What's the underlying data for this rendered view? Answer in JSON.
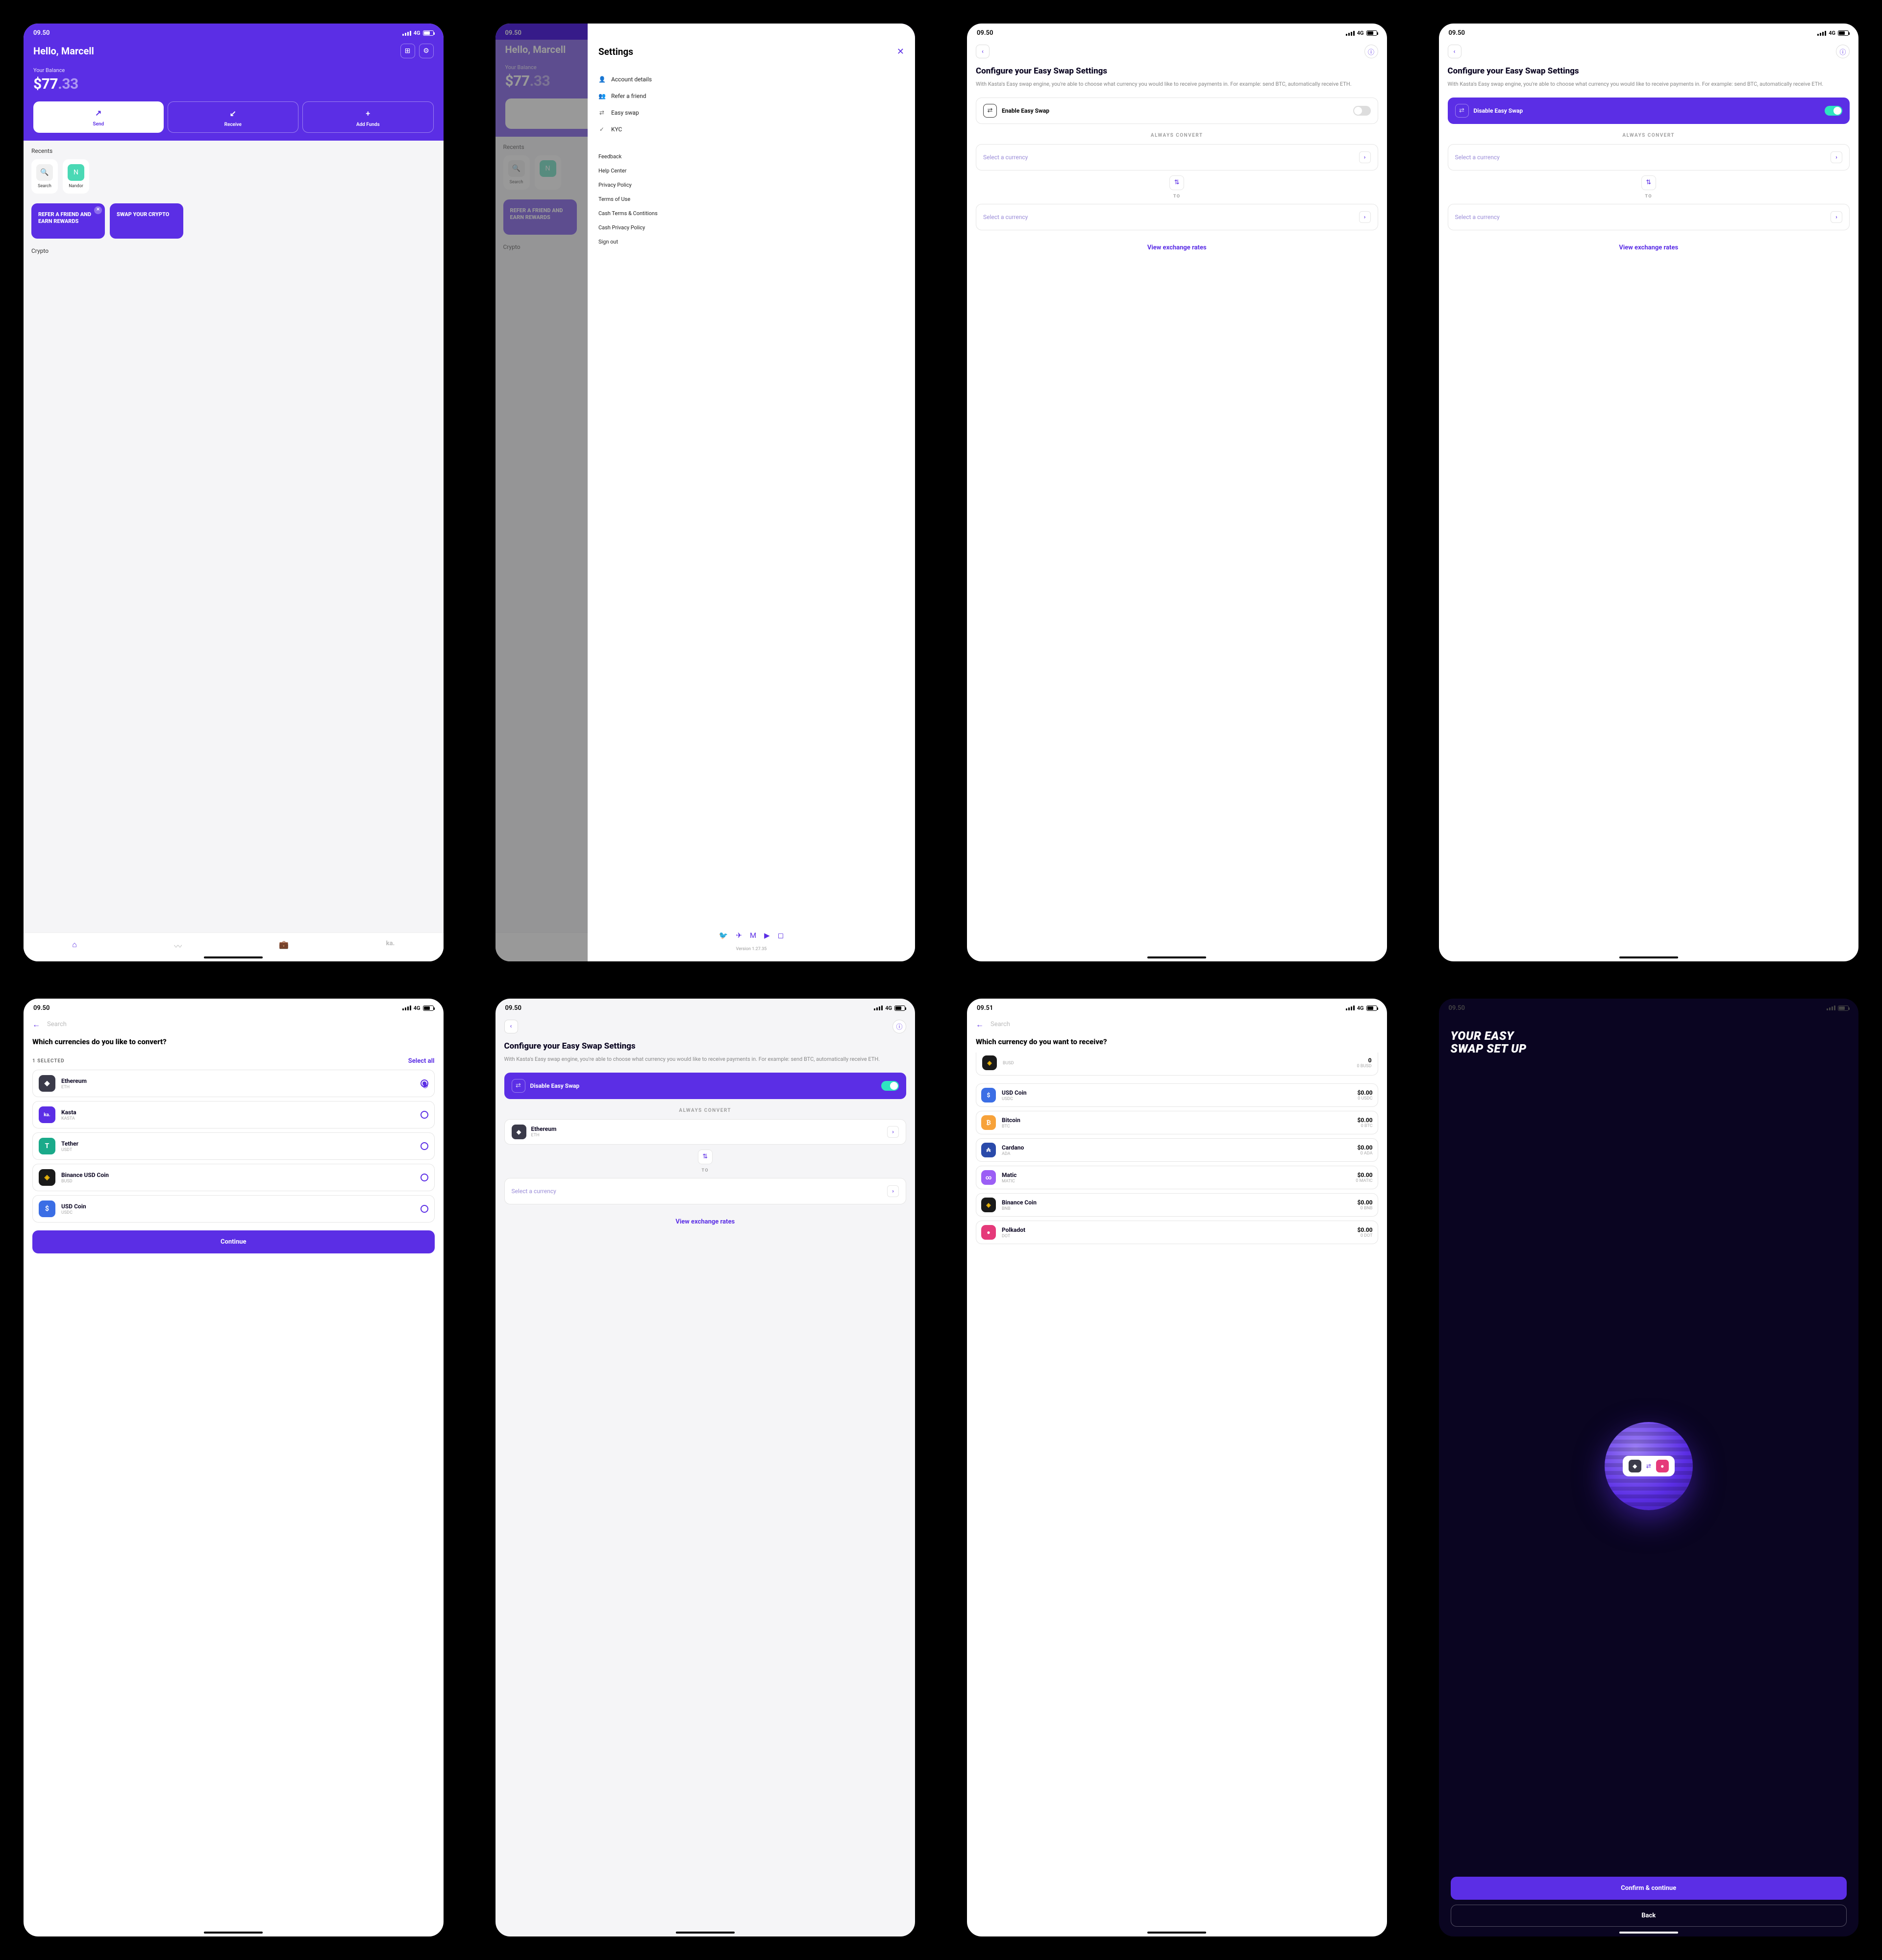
{
  "status": {
    "time": "09.50",
    "time_alt": "09.51",
    "network": "4G"
  },
  "home": {
    "greeting": "Hello, Marcell",
    "balance_label": "Your Balance",
    "balance_whole": "$77",
    "balance_cents": ".33",
    "send": "Send",
    "receive": "Receive",
    "add_funds": "Add Funds",
    "recents_label": "Recents",
    "search_chip": "Search",
    "contact1": "Nandor",
    "promo1": "REFER A FRIEND AND EARN REWARDS",
    "promo2": "SWAP YOUR CRYPTO",
    "crypto_label": "Crypto"
  },
  "settings": {
    "title": "Settings",
    "items": [
      {
        "icon": "👤",
        "label": "Account details"
      },
      {
        "icon": "👥",
        "label": "Refer a friend"
      },
      {
        "icon": "⇄",
        "label": "Easy swap"
      },
      {
        "icon": "✓",
        "label": "KYC"
      }
    ],
    "links": [
      "Feedback",
      "Help Center",
      "Privacy Policy",
      "Terms of Use",
      "Cash Terms & Contitions",
      "Cash Privacy Policy",
      "Sign out"
    ],
    "version": "Version 1.27.35"
  },
  "config": {
    "title": "Configure your Easy Swap Settings",
    "desc": "With Kasta's Easy swap engine, you're able to choose what currency you would like to receive payments in. For example: send BTC, automatically receive ETH.",
    "enable": "Enable Easy Swap",
    "disable": "Disable Easy Swap",
    "always": "ALWAYS CONVERT",
    "to": "TO",
    "select_ph": "Select a currency",
    "rates": "View exchange rates",
    "eth_name": "Ethereum",
    "eth_sym": "ETH"
  },
  "l1": {
    "title": "Which currencies do you like to convert?",
    "selected": "1 SELECTED",
    "select_all": "Select all",
    "search": "Search",
    "continue": "Continue",
    "items": [
      {
        "name": "Ethereum",
        "sym": "ETH",
        "color": "#3b3b4a",
        "icon": "◆",
        "checked": true
      },
      {
        "name": "Kasta",
        "sym": "KASTA",
        "color": "#5b2ee5",
        "icon": "ka.",
        "checked": false
      },
      {
        "name": "Tether",
        "sym": "USDT",
        "color": "#1aaa8a",
        "icon": "T",
        "checked": false
      },
      {
        "name": "Binance USD Coin",
        "sym": "BUSD",
        "color": "#1a1a1a",
        "icon": "◈",
        "checked": false
      },
      {
        "name": "USD Coin",
        "sym": "USDC",
        "color": "#3b6ee5",
        "icon": "$",
        "checked": false
      }
    ]
  },
  "l2": {
    "title": "Which currency do you want to receive?",
    "search": "Search",
    "partial": {
      "sym": "BUSD",
      "amt": "0",
      "bal": "0 BUSD"
    },
    "items": [
      {
        "name": "USD Coin",
        "sym": "USDC",
        "color": "#3b6ee5",
        "icon": "$",
        "amt": "$0.00",
        "bal": "0 USDC"
      },
      {
        "name": "Bitcoin",
        "sym": "BTC",
        "color": "#f7a23a",
        "icon": "₿",
        "amt": "$0.00",
        "bal": "0 BTC"
      },
      {
        "name": "Cardano",
        "sym": "ADA",
        "color": "#2a4aaa",
        "icon": "₳",
        "amt": "$0.00",
        "bal": "0 ADA"
      },
      {
        "name": "Matic",
        "sym": "MATIC",
        "color": "#9b5ef5",
        "icon": "∞",
        "amt": "$0.00",
        "bal": "0 MATIC"
      },
      {
        "name": "Binance Coin",
        "sym": "BNB",
        "color": "#1a1a1a",
        "icon": "◈",
        "amt": "$0.00",
        "bal": "0 BNB"
      },
      {
        "name": "Polkadot",
        "sym": "DOT",
        "color": "#e53a7a",
        "icon": "●",
        "amt": "$0.00",
        "bal": "0 DOT"
      }
    ]
  },
  "success": {
    "title_l1": "YOUR EASY",
    "title_l2": "SWAP SET UP",
    "confirm": "Confirm & continue",
    "back": "Back"
  }
}
